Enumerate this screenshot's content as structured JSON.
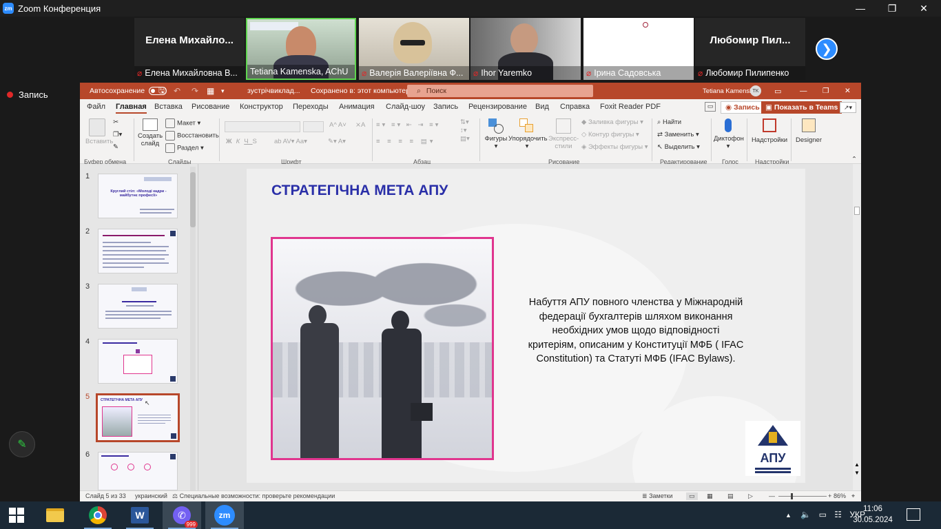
{
  "zoom": {
    "title": "Zoom Конференция",
    "logo": "zm",
    "record_label": "Запись",
    "participants": [
      {
        "name": "Елена Михайловна В...",
        "big_name": "Елена  Михайло...",
        "video": false,
        "muted": true
      },
      {
        "name": "Tetiana Kamenska, AChU",
        "video": true,
        "muted": false,
        "active": true
      },
      {
        "name": "Валерія Валеріївна Ф...",
        "video": true,
        "muted": true
      },
      {
        "name": "Ihor Yaremko",
        "video": true,
        "muted": true
      },
      {
        "name": "Ірина Садовська",
        "video": true,
        "muted": true
      },
      {
        "name": "Любомир Пилипенко",
        "big_name": "Любомир  Пил...",
        "video": false,
        "muted": true
      }
    ]
  },
  "ppt": {
    "autosave_label": "Автосохранение",
    "filename": "зустрічвиклад...",
    "saved_status": "Сохранено в: этот компьютер",
    "search_placeholder": "Поиск",
    "user_name": "Tetiana Kamenska",
    "user_initials": "TK",
    "menu": [
      "Файл",
      "Главная",
      "Вставка",
      "Рисование",
      "Конструктор",
      "Переходы",
      "Анимация",
      "Слайд-шоу",
      "Запись",
      "Рецензирование",
      "Вид",
      "Справка",
      "Foxit Reader PDF"
    ],
    "active_menu": "Главная",
    "record_btn": "Запись",
    "teams_btn": "Показать в Teams",
    "ribbon": {
      "paste": "Вставить",
      "clipboard": "Буфер обмена",
      "new_slide_1": "Создать",
      "new_slide_2": "слайд",
      "layout": "Макет",
      "reset": "Восстановить",
      "section": "Раздел",
      "slides": "Слайды",
      "font": "Шрифт",
      "paragraph": "Абзац",
      "shapes": "Фигуры",
      "arrange": "Упорядочить",
      "quick_styles_1": "Экспресс-",
      "quick_styles_2": "стили",
      "shape_fill": "Заливка фигуры",
      "shape_outline": "Контур фигуры",
      "shape_effects": "Эффекты фигуры",
      "drawing": "Рисование",
      "find": "Найти",
      "replace": "Заменить",
      "select": "Выделить",
      "editing": "Редактирование",
      "dictate": "Диктофон",
      "voice": "Голос",
      "addins": "Надстройки",
      "addins_group": "Надстройки",
      "designer": "Designer"
    },
    "slide": {
      "title": "СТРАТЕГІЧНА МЕТА АПУ",
      "text_line1": "Набуття АПУ повного членства у Міжнародній",
      "text_line2": "федерації бухгалтерів  шляхом виконання",
      "text_line3": "необхідних умов щодо відповідності",
      "text_line4": "критеріям, описаним у Конституції МФБ ( IFAC",
      "text_line5": "Constitution) та Статуті МФБ (IFAC Bylaws).",
      "logo_text": "АПУ"
    },
    "thumbnails": [
      {
        "num": "1",
        "title": "Круглий стіл: «Молоді кадри - майбутнє професії»"
      },
      {
        "num": "2"
      },
      {
        "num": "3"
      },
      {
        "num": "4"
      },
      {
        "num": "5",
        "title": "СТРАТЕГІЧНА МЕТА АПУ",
        "selected": true
      },
      {
        "num": "6"
      }
    ],
    "status": {
      "slide_count": "Слайд 5 из 33",
      "language": "украинский",
      "accessibility": "Специальные возможности: проверьте рекомендации",
      "notes": "Заметки",
      "zoom": "86%"
    }
  },
  "taskbar": {
    "apps": [
      "windows-start",
      "file-explorer",
      "chrome",
      "word",
      "viber",
      "zoom"
    ],
    "viber_badge": "999",
    "language": "УКР",
    "time": "11:06",
    "date": "30.05.2024"
  }
}
